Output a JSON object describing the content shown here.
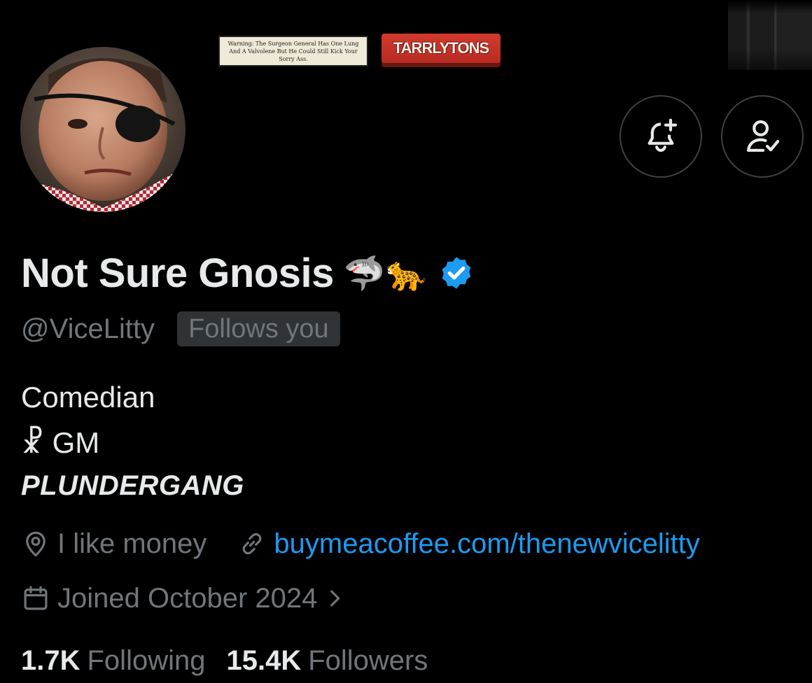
{
  "banner": {
    "warning_text": "Warning: The Surgeon General Has One Lung And A Valvolene But He Could Still Kick Your Sorry Ass.",
    "brand_logo_text": "TARRLYTONS"
  },
  "profile": {
    "display_name": "Not Sure Gnosis",
    "emojis": "🦈🐆",
    "handle": "@ViceLitty",
    "follows_you_label": "Follows you",
    "bio": {
      "line1": "Comedian",
      "line2": "☧ GM",
      "line3": "PLUNDERGANG"
    },
    "location": "I like money",
    "website": "buymeacoffee.com/thenewvicelitty",
    "joined": "Joined October 2024"
  },
  "stats": {
    "following_count": "1.7K",
    "following_label": "Following",
    "followers_count": "15.4K",
    "followers_label": "Followers"
  },
  "icons": {
    "notify": "bell-plus-icon",
    "following": "person-check-icon",
    "verified": "verified-badge-icon",
    "location": "location-pin-icon",
    "link": "link-icon",
    "calendar": "calendar-icon",
    "chevron": "chevron-right-icon"
  },
  "colors": {
    "background": "#000000",
    "text_primary": "#e7e9ea",
    "text_secondary": "#71767b",
    "link": "#1d9bf0",
    "verified": "#1d9bf0",
    "badge_bg": "#2f3336",
    "button_border": "#3e4144"
  }
}
